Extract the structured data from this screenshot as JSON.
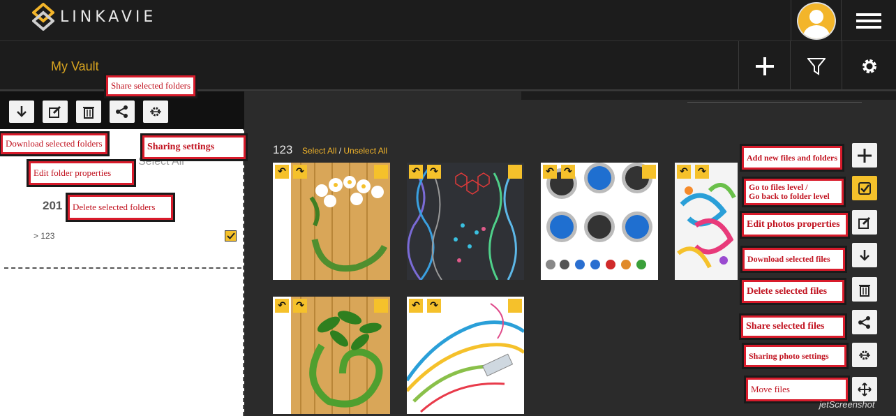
{
  "header": {
    "logo_text": "LINKAVIE",
    "avatar_icon": "user-avatar-icon",
    "menu_icon": "hamburger-menu-icon"
  },
  "subbar": {
    "title": "My Vault",
    "add_icon": "plus-icon",
    "filter_icon": "filter-icon",
    "settings_icon": "gear-icon"
  },
  "left_panel": {
    "toolbar_icons": [
      "download-icon",
      "edit-icon",
      "trash-icon",
      "share-icon",
      "sharing-settings-icon"
    ],
    "select_all": "Select All",
    "year": "201",
    "folder_name": "> 123"
  },
  "main": {
    "album_name": "123",
    "select_all": "Select All",
    "separator": " / ",
    "unselect_all": "Unselect All"
  },
  "right_toolbar": {
    "icons": [
      "plus-icon",
      "check-icon",
      "edit-icon",
      "download-icon",
      "trash-icon",
      "share-icon",
      "sharing-settings-icon",
      "move-icon"
    ]
  },
  "callouts": {
    "share_folders": "Share selected folders",
    "download_folders": "Download selected folders",
    "sharing_settings": "Sharing settings",
    "edit_folder": "Edit folder properties",
    "delete_folders": "Delete selected folders",
    "add_files": "Add new files and folders",
    "files_level_1": "Go to files level /",
    "files_level_2": "Go back to folder level",
    "edit_photos": "Edit photos properties",
    "download_files": "Download selected files",
    "delete_files": "Delete selected files",
    "share_files": "Share selected files",
    "sharing_photo": "Sharing photo settings",
    "move_files": "Move files"
  },
  "watermark": "jetScreenshot",
  "colors": {
    "accent": "#f3b52a",
    "callout_red": "#d81b2b",
    "background": "#2b2b2b",
    "header": "#1c1c1c"
  }
}
